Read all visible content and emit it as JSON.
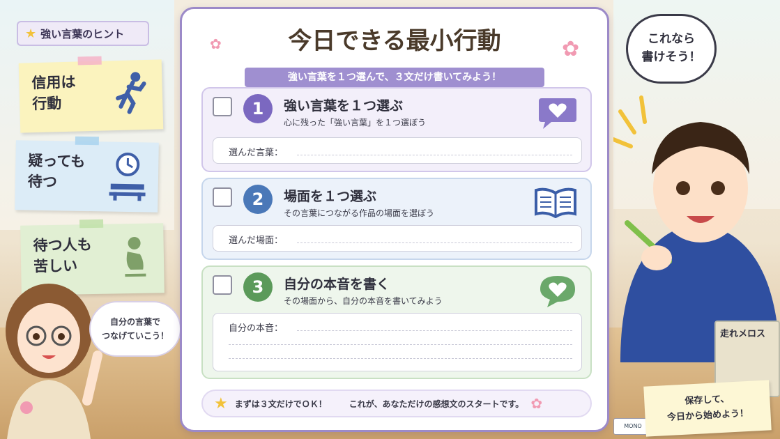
{
  "hints": {
    "title": "強い言葉のヒント",
    "notes": [
      {
        "line1": "信用は",
        "line2": "行動",
        "icon": "running-person-icon",
        "tape_color": "#f5b3c8"
      },
      {
        "line1": "疑っても",
        "line2": "待つ",
        "icon": "clock-bench-icon",
        "tape_color": "#a9d3ef"
      },
      {
        "line1": "待つ人も",
        "line2": "苦しい",
        "icon": "sitting-person-icon",
        "tape_color": "#bfe0a8"
      }
    ]
  },
  "worksheet": {
    "title": "今日できる最小行動",
    "subtitle": "強い言葉を１つ選んで、３文だけ書いてみよう！",
    "steps": [
      {
        "number": "1",
        "heading": "強い言葉を１つ選ぶ",
        "description": "心に残った「強い言葉」を１つ選ぼう",
        "field_label": "選んだ言葉：",
        "icon": "heart-speech-bubble-icon",
        "checked": false
      },
      {
        "number": "2",
        "heading": "場面を１つ選ぶ",
        "description": "その言葉につながる作品の場面を選ぼう",
        "field_label": "選んだ場面：",
        "icon": "open-book-icon",
        "checked": false
      },
      {
        "number": "3",
        "heading": "自分の本音を書く",
        "description": "その場面から、自分の本音を書いてみよう",
        "field_label": "自分の本音：",
        "icon": "heart-speech-bubble-icon",
        "checked": false
      }
    ],
    "footer": {
      "part1": "まずは３文だけでＯＫ！",
      "part2": "これが、あなただけの感想文のスタートです。"
    }
  },
  "girl_bubble": {
    "line1": "自分の言葉で",
    "line2": "つなげていこう！"
  },
  "boy_bubble": {
    "line1": "これなら",
    "line2": "書けそう！"
  },
  "save_note": {
    "line1": "保存して、",
    "line2": "今日から始めよう！"
  },
  "book_title": "走れメロス",
  "eraser_text": "MONO",
  "colors": {
    "accent": "#9c8ac8",
    "step1": "#7b68c0",
    "step2": "#4a78b8",
    "step3": "#5b9a5a"
  }
}
